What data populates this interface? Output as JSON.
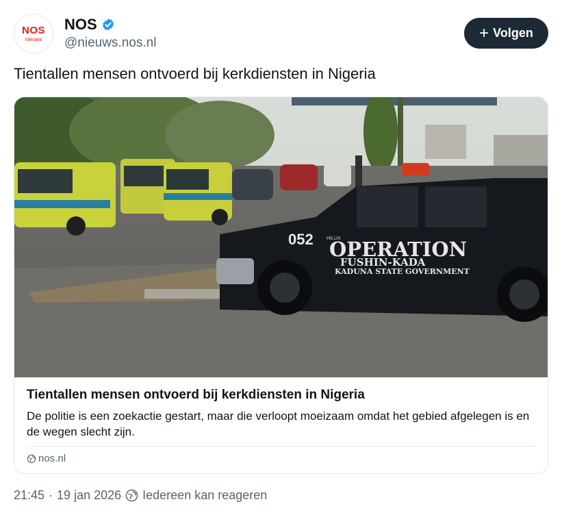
{
  "author": {
    "display_name": "NOS",
    "handle": "@nieuws.nos.nl",
    "avatar_logo": "NOS",
    "avatar_sub": "nieuws",
    "verified": true
  },
  "follow_button": {
    "icon": "plus-icon",
    "label": "Volgen"
  },
  "post": {
    "text": "Tientallen mensen ontvoerd bij kerkdiensten in Nigeria"
  },
  "link_card": {
    "image": {
      "vehicle_number": "052",
      "vehicle_model": "HILUX",
      "vehicle_text_line1": "OPERATION",
      "vehicle_text_line2": "FUSHIN-KADA",
      "vehicle_text_line3": "KADUNA STATE GOVERNMENT"
    },
    "title": "Tientallen mensen ontvoerd bij kerkdiensten in Nigeria",
    "description": "De politie is een zoekactie gestart, maar die verloopt moeizaam omdat het gebied afgelegen is en de wegen slecht zijn.",
    "source_icon": "globe-icon",
    "source": "nos.nl"
  },
  "meta": {
    "time": "21:45",
    "separator": "·",
    "date": "19 jan 2026",
    "reply_icon": "reply-settings-icon",
    "reply_setting": "Iedereen kan reageren"
  },
  "colors": {
    "follow_bg": "#1d2a36",
    "verified_blue": "#1d9bf0",
    "nos_red": "#e61e14",
    "secondary_text": "#536471"
  }
}
